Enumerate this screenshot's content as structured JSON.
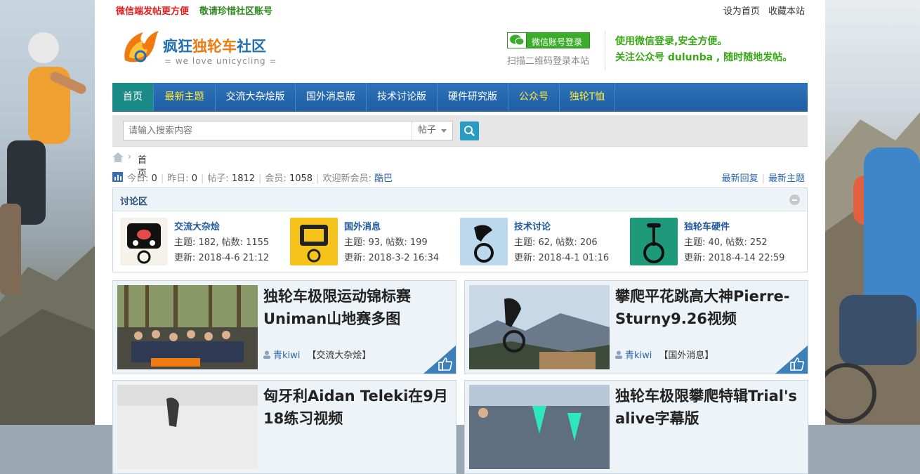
{
  "topbar": {
    "tip_weixin": "微信端发帖更方便",
    "tip_cherish": "敬请珍惜社区账号",
    "set_home": "设为首页",
    "favorite": "收藏本站"
  },
  "header": {
    "logo_part1": "疯狂",
    "logo_part2": "独轮车",
    "logo_part3": "社区",
    "logo_sub": "= we love unicycling =",
    "wx_login": "微信账号登录",
    "wx_scan": "扫描二维码登录本站",
    "wx_info_1": "使用微信登录,安全方便。",
    "wx_info_2": "关注公众号 dulunba , 随时随地发帖。"
  },
  "nav": {
    "items": [
      {
        "label": "首页"
      },
      {
        "label": "最新主题"
      },
      {
        "label": "交流大杂烩版"
      },
      {
        "label": "国外消息版"
      },
      {
        "label": "技术讨论版"
      },
      {
        "label": "硬件研究版"
      },
      {
        "label": "公众号"
      },
      {
        "label": "独轮T恤"
      }
    ]
  },
  "search": {
    "placeholder": "请输入搜索内容",
    "type": "帖子"
  },
  "breadcrumb": {
    "current": "首页"
  },
  "stats": {
    "today_label": "今日:",
    "today": "0",
    "yesterday_label": "昨日:",
    "yesterday": "0",
    "posts_label": "帖子:",
    "posts": "1812",
    "members_label": "会员:",
    "members": "1058",
    "welcome_label": "欢迎新会员:",
    "new_member": "酷巴",
    "latest_replies": "最新回复",
    "latest_topics": "最新主题"
  },
  "forum": {
    "title": "讨论区",
    "boards": [
      {
        "name": "交流大杂烩",
        "meta": "主题: 182, 帖数: 1155",
        "updated": "更新: 2018-4-6 21:12"
      },
      {
        "name": "国外消息",
        "meta": "主题: 93, 帖数: 199",
        "updated": "更新: 2018-3-2 16:34"
      },
      {
        "name": "技术讨论",
        "meta": "主题: 62, 帖数: 206",
        "updated": "更新: 2018-4-1 01:16"
      },
      {
        "name": "独轮车硬件",
        "meta": "主题: 40, 帖数: 252",
        "updated": "更新: 2018-4-14 22:59"
      }
    ]
  },
  "features": [
    {
      "title": "独轮车极限运动锦标赛Uniman山地赛多图",
      "author": "青kiwi",
      "category": "【交流大杂烩】"
    },
    {
      "title": "攀爬平花跳高大神Pierre-Sturny9.26视频",
      "author": "青kiwi",
      "category": "【国外消息】"
    },
    {
      "title": "匈牙利Aidan Teleki在9月18练习视频",
      "author": "",
      "category": ""
    },
    {
      "title": "独轮车极限攀爬特辑Trial's alive字幕版",
      "author": "",
      "category": ""
    }
  ],
  "colors": {
    "nav_bg": "#1e5ea5",
    "nav_active": "#1a8a86",
    "nav_highlight": "#ffea3a",
    "link": "#2a67a8",
    "weixin_green": "#3aae2a",
    "alert_red": "#e02020"
  }
}
